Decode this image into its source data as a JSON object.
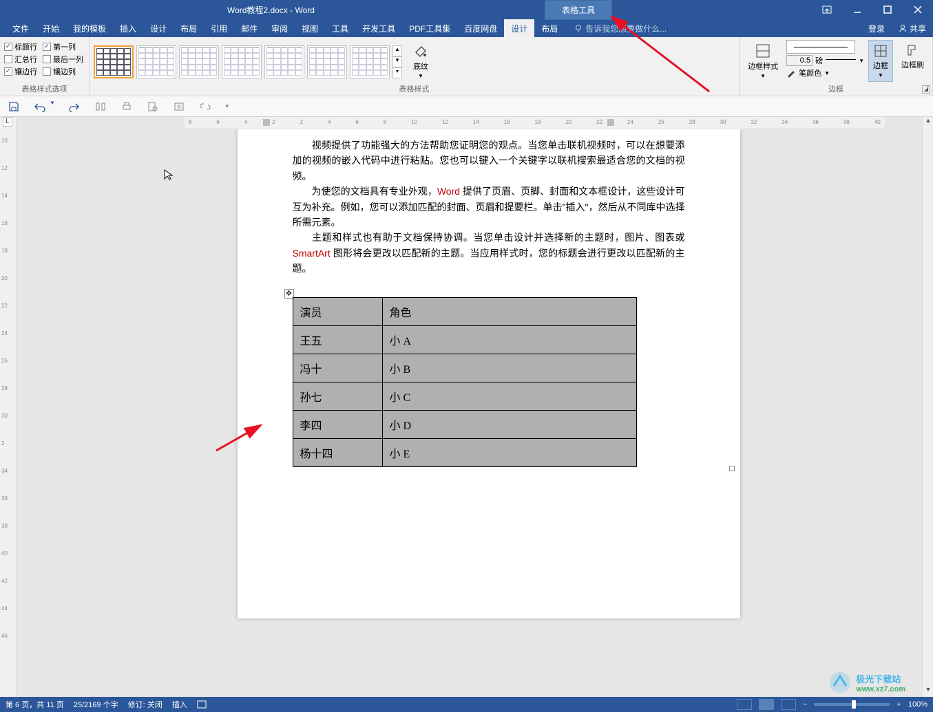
{
  "title": "Word教程2.docx - Word",
  "context_tab": "表格工具",
  "window": {
    "login": "登录",
    "share": "共享"
  },
  "ribbon": {
    "tabs": [
      "文件",
      "开始",
      "我的模板",
      "插入",
      "设计",
      "布局",
      "引用",
      "邮件",
      "审阅",
      "视图",
      "工具",
      "开发工具",
      "PDF工具集",
      "百度网盘",
      "设计",
      "布局"
    ],
    "active_index": 14,
    "tell_me": "告诉我您想要做什么...",
    "groups": {
      "style_options": {
        "label": "表格样式选项",
        "header_row": "标题行",
        "first_col": "第一列",
        "total_row": "汇总行",
        "last_col": "最后一列",
        "banded_row": "镶边行",
        "banded_col": "镶边列",
        "chk_header_row": true,
        "chk_first_col": true,
        "chk_total_row": false,
        "chk_last_col": false,
        "chk_banded_row": true,
        "chk_banded_col": false
      },
      "styles": {
        "label": "表格样式",
        "shading": "底纹"
      },
      "borders": {
        "label": "边框",
        "border_styles": "边框样式",
        "pen_width": "0.5",
        "pen_unit": "磅",
        "pen_color": "笔颜色",
        "border_btn": "边框",
        "painter": "边框刷"
      }
    }
  },
  "document": {
    "para1": "视频提供了功能强大的方法帮助您证明您的观点。当您单击联机视频时，可以在想要添加的视频的嵌入代码中进行粘贴。您也可以键入一个关键字以联机搜索最适合您的文档的视频。",
    "para2a": "为使您的文档具有专业外观，",
    "para2_word": "Word",
    "para2b": " 提供了页眉、页脚、封面和文本框设计，这些设计可互为补充。例如，您可以添加匹配的封面、页眉和提要栏。单击\"插入\"，然后从不同库中选择所需元素。",
    "para3a": "主题和样式也有助于文档保持协调。当您单击设计并选择新的主题时，图片、图表或 ",
    "para3_smartart": "SmartArt",
    "para3b": " 图形将会更改以匹配新的主题。当应用样式时，您的标题会进行更改以匹配新的主题。"
  },
  "table": {
    "header": [
      "演员",
      "角色"
    ],
    "rows": [
      [
        "王五",
        "小 A"
      ],
      [
        "冯十",
        "小 B"
      ],
      [
        "孙七",
        "小 C"
      ],
      [
        "李四",
        "小 D"
      ],
      [
        "杨十四",
        "小 E"
      ]
    ]
  },
  "ruler": {
    "h": [
      "8",
      "6",
      "4",
      "2",
      "2",
      "4",
      "6",
      "8",
      "10",
      "12",
      "14",
      "16",
      "18",
      "20",
      "22",
      "24",
      "26",
      "28",
      "30",
      "32",
      "34",
      "36",
      "38",
      "40"
    ],
    "v": [
      "10",
      "12",
      "14",
      "16",
      "18",
      "20",
      "22",
      "24",
      "26",
      "28",
      "30",
      "2",
      "34",
      "36",
      "38",
      "40",
      "42",
      "44",
      "46"
    ]
  },
  "status": {
    "page": "第 6 页，共 11 页",
    "words": "25/2169 个字",
    "revision": "修订: 关闭",
    "mode": "插入",
    "zoom": "100%"
  },
  "watermark": {
    "line1": "极光下载站",
    "line2": "www.xz7.com"
  }
}
